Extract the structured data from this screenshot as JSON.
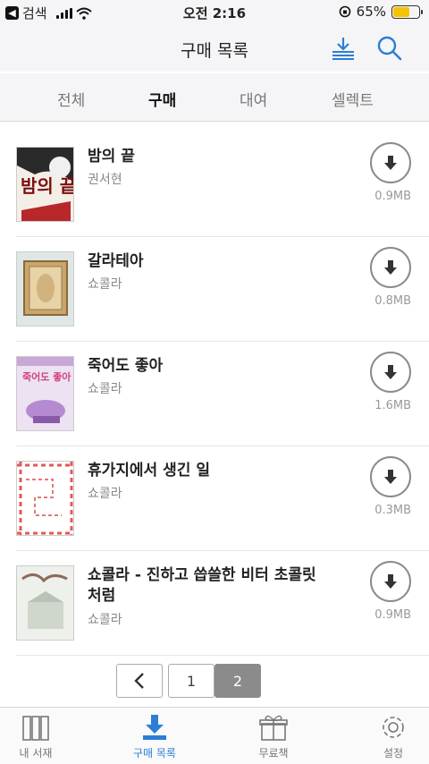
{
  "status_bar": {
    "back_app": "검색",
    "time": "오전 2:16",
    "battery": "65%",
    "battery_level": 0.65
  },
  "header": {
    "title": "구매 목록",
    "download_icon": "download-all-icon",
    "search_icon": "search-icon"
  },
  "tabs": [
    {
      "label": "전체",
      "active": false
    },
    {
      "label": "구매",
      "active": true
    },
    {
      "label": "대여",
      "active": false
    },
    {
      "label": "셀렉트",
      "active": false
    }
  ],
  "books": [
    {
      "title": "밤의 끝",
      "author": "권서현",
      "size": "0.9MB"
    },
    {
      "title": "갈라테아",
      "author": "쇼콜라",
      "size": "0.8MB"
    },
    {
      "title": "죽어도 좋아",
      "author": "쇼콜라",
      "size": "1.6MB"
    },
    {
      "title": "휴가지에서 생긴 일",
      "author": "쇼콜라",
      "size": "0.3MB"
    },
    {
      "title": "쇼콜라 - 진하고 씁쓸한 비터 초콜릿 처럼",
      "author": "쇼콜라",
      "size": "0.9MB"
    }
  ],
  "cover_text": {
    "c1": "밤의 끝",
    "c3": "죽어도 좋아"
  },
  "pagination": {
    "pages": [
      "1",
      "2"
    ],
    "current": "2"
  },
  "bottom_nav": [
    {
      "label": "내 서재",
      "icon": "bookshelf-icon",
      "active": false
    },
    {
      "label": "구매 목록",
      "icon": "download-tray-icon",
      "active": true
    },
    {
      "label": "무료책",
      "icon": "gift-icon",
      "active": false
    },
    {
      "label": "설정",
      "icon": "gear-icon",
      "active": false
    }
  ],
  "colors": {
    "accent": "#2b7ed4",
    "header_bg": "#f5f5f7",
    "battery": "#f5c400"
  }
}
